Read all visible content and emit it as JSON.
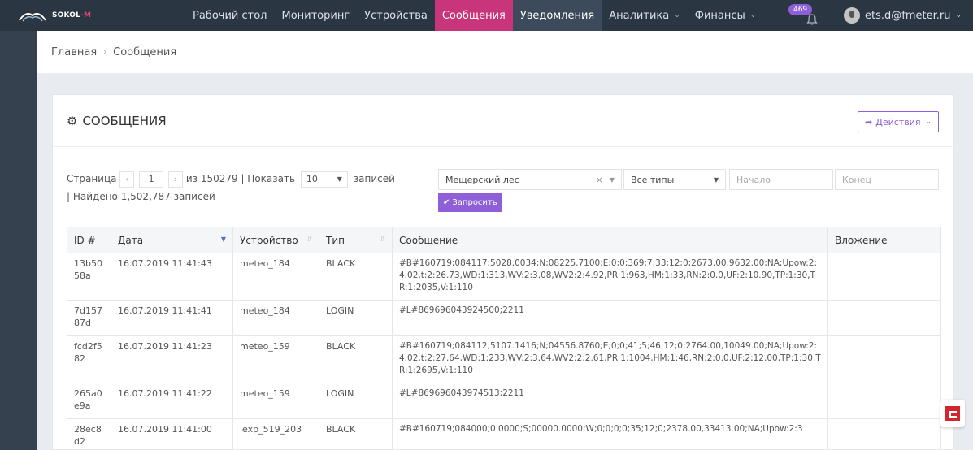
{
  "brand": {
    "name": "SOKOL",
    "suffix": "-M"
  },
  "nav": [
    {
      "label": "Рабочий стол",
      "state": ""
    },
    {
      "label": "Мониторинг",
      "state": ""
    },
    {
      "label": "Устройства",
      "state": ""
    },
    {
      "label": "Сообщения",
      "state": "active"
    },
    {
      "label": "Уведомления",
      "state": "secondary"
    },
    {
      "label": "Аналитика",
      "state": "dropdown"
    },
    {
      "label": "Финансы",
      "state": "dropdown"
    }
  ],
  "notifications": {
    "count": "469"
  },
  "user": {
    "email": "ets.d@fmeter.ru"
  },
  "breadcrumb": {
    "home": "Главная",
    "current": "Сообщения"
  },
  "panel": {
    "title": "СООБЩЕНИЯ",
    "actions_label": "Действия"
  },
  "pager": {
    "page_label": "Страница",
    "page": "1",
    "of_text": "из 150279 | Показать",
    "page_size": "10",
    "records_label": "записей",
    "found_text": "| Найдено 1,502,787 записей"
  },
  "filters": {
    "location": "Мещерский лес",
    "type": "Все типы",
    "start_placeholder": "Начало",
    "end_placeholder": "Конец",
    "submit_label": "Запросить"
  },
  "table": {
    "columns": [
      "ID #",
      "Дата",
      "Устройство",
      "Тип",
      "Сообщение",
      "Вложение"
    ],
    "rows": [
      {
        "id": "13b5058a",
        "date": "16.07.2019 11:41:43",
        "device": "meteo_184",
        "type": "BLACK",
        "message": "#B#160719;084117;5028.0034;N;08225.7100;E;0;0;369;7;33;12;0;2673.00,9632.00;NA;Upow:2:4.02,t:2:26.73,WD:1:313,WV:2:3.08,WV2:2:4.92,PR:1:963,HM:1:33,RN:2:0.0,UF:2:10.90,TP:1:30,TR:1:2035,V:1:110",
        "attachment": ""
      },
      {
        "id": "7d15787d",
        "date": "16.07.2019 11:41:41",
        "device": "meteo_184",
        "type": "LOGIN",
        "message": "#L#869696043924500;2211",
        "attachment": ""
      },
      {
        "id": "fcd2f582",
        "date": "16.07.2019 11:41:23",
        "device": "meteo_159",
        "type": "BLACK",
        "message": "#B#160719;084112;5107.1416;N;04556.8760;E;0;0;41;5;46;12;0;2764.00,10049.00;NA;Upow:2:4.02,t:2:27.64,WD:1:233,WV:2:3.64,WV2:2:2.61,PR:1:1004,HM:1:46,RN:2:0.0,UF:2:12.00,TP:1:30,TR:1:2695,V:1:110",
        "attachment": ""
      },
      {
        "id": "265a0e9a",
        "date": "16.07.2019 11:41:22",
        "device": "meteo_159",
        "type": "LOGIN",
        "message": "#L#869696043974513;2211",
        "attachment": ""
      },
      {
        "id": "28ec8d2",
        "date": "16.07.2019 11:41:00",
        "device": "lexp_519_203",
        "type": "BLACK",
        "message": "#B#160719;084000;0.0000;S;00000.0000;W;0;0;0;0;35;12;0;2378.00,33413.00;NA;Upow:2:3",
        "attachment": ""
      }
    ]
  }
}
